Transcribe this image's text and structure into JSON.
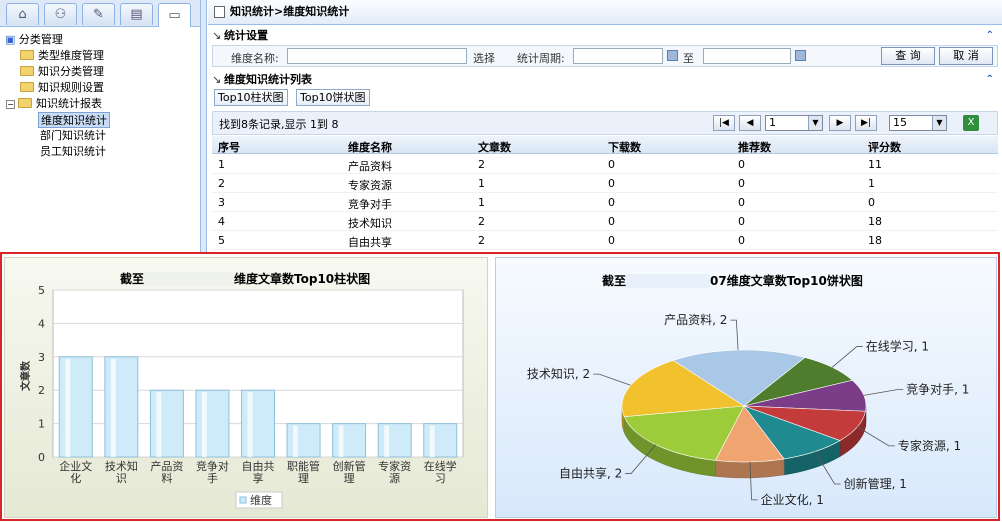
{
  "tree": {
    "root": "分类管理",
    "items": [
      "类型维度管理",
      "知识分类管理",
      "知识规则设置",
      "知识统计报表"
    ],
    "children": [
      "维度知识统计",
      "部门知识统计",
      "员工知识统计"
    ]
  },
  "breadcrumb": "知识统计>维度知识统计",
  "settings": {
    "title": "统计设置",
    "dim_label": "维度名称:",
    "select_label": "选择",
    "period_label": "统计周期:",
    "to_label": "至",
    "query": "查 询",
    "cancel": "取 消"
  },
  "list": {
    "title": "维度知识统计列表",
    "tab_bar": "Top10柱状图",
    "tab_pie": "Top10饼状图",
    "found_text": "找到8条记录,显示 1到 8",
    "page": "1",
    "page_size": "15"
  },
  "table": {
    "columns": [
      "序号",
      "维度名称",
      "文章数",
      "下载数",
      "推荐数",
      "评分数"
    ],
    "rows": [
      [
        "1",
        "产品资料",
        "2",
        "0",
        "0",
        "11"
      ],
      [
        "2",
        "专家资源",
        "1",
        "0",
        "0",
        "1"
      ],
      [
        "3",
        "竞争对手",
        "1",
        "0",
        "0",
        "0"
      ],
      [
        "4",
        "技术知识",
        "2",
        "0",
        "0",
        "18"
      ],
      [
        "5",
        "自由共享",
        "2",
        "0",
        "0",
        "18"
      ]
    ]
  },
  "bar_chart": {
    "title_prefix": "截至",
    "title_suffix": "维度文章数Top10柱状图",
    "ylabel": "文章数",
    "legend": "维度",
    "bar_color": "#cfeaf8"
  },
  "pie_chart": {
    "title_prefix": "截至",
    "title_suffix": "07维度文章数Top10饼状图"
  },
  "chart_data": [
    {
      "type": "bar",
      "categories": [
        "企业文化",
        "技术知识",
        "产品资料",
        "竞争对手",
        "自由共享",
        "职能管理",
        "创新管理",
        "专家资源",
        "在线学习"
      ],
      "category_lines": [
        [
          "企业文",
          "化"
        ],
        [
          "技术知",
          "识"
        ],
        [
          "产品资",
          "料"
        ],
        [
          "竞争对",
          "手"
        ],
        [
          "自由共",
          "享"
        ],
        [
          "职能管",
          "理"
        ],
        [
          "创新管",
          "理"
        ],
        [
          "专家资",
          "源"
        ],
        [
          "在线学",
          "习"
        ]
      ],
      "values": [
        3,
        3,
        2,
        2,
        2,
        1,
        1,
        1,
        1
      ],
      "ylim": [
        0,
        5
      ],
      "yticks": [
        "0",
        "1",
        "2",
        "3",
        "4",
        "5"
      ],
      "grid": true,
      "legend": "bottom"
    },
    {
      "type": "pie",
      "slices": [
        {
          "label": "产品资料, 2",
          "value": 2,
          "color": "#a9c7e6"
        },
        {
          "label": "在线学习, 1",
          "value": 1,
          "color": "#4e7d2e"
        },
        {
          "label": "竞争对手, 1",
          "value": 1,
          "color": "#7b3c88"
        },
        {
          "label": "专家资源, 1",
          "value": 1,
          "color": "#c33b3b"
        },
        {
          "label": "创新管理, 1",
          "value": 1,
          "color": "#1f8a8f"
        },
        {
          "label": "企业文化, 1",
          "value": 1,
          "color": "#f0a470"
        },
        {
          "label": "自由共享, 2",
          "value": 2,
          "color": "#9ccc3a"
        },
        {
          "label": "技术知识, 2",
          "value": 2,
          "color": "#f2c12e"
        }
      ]
    }
  ]
}
